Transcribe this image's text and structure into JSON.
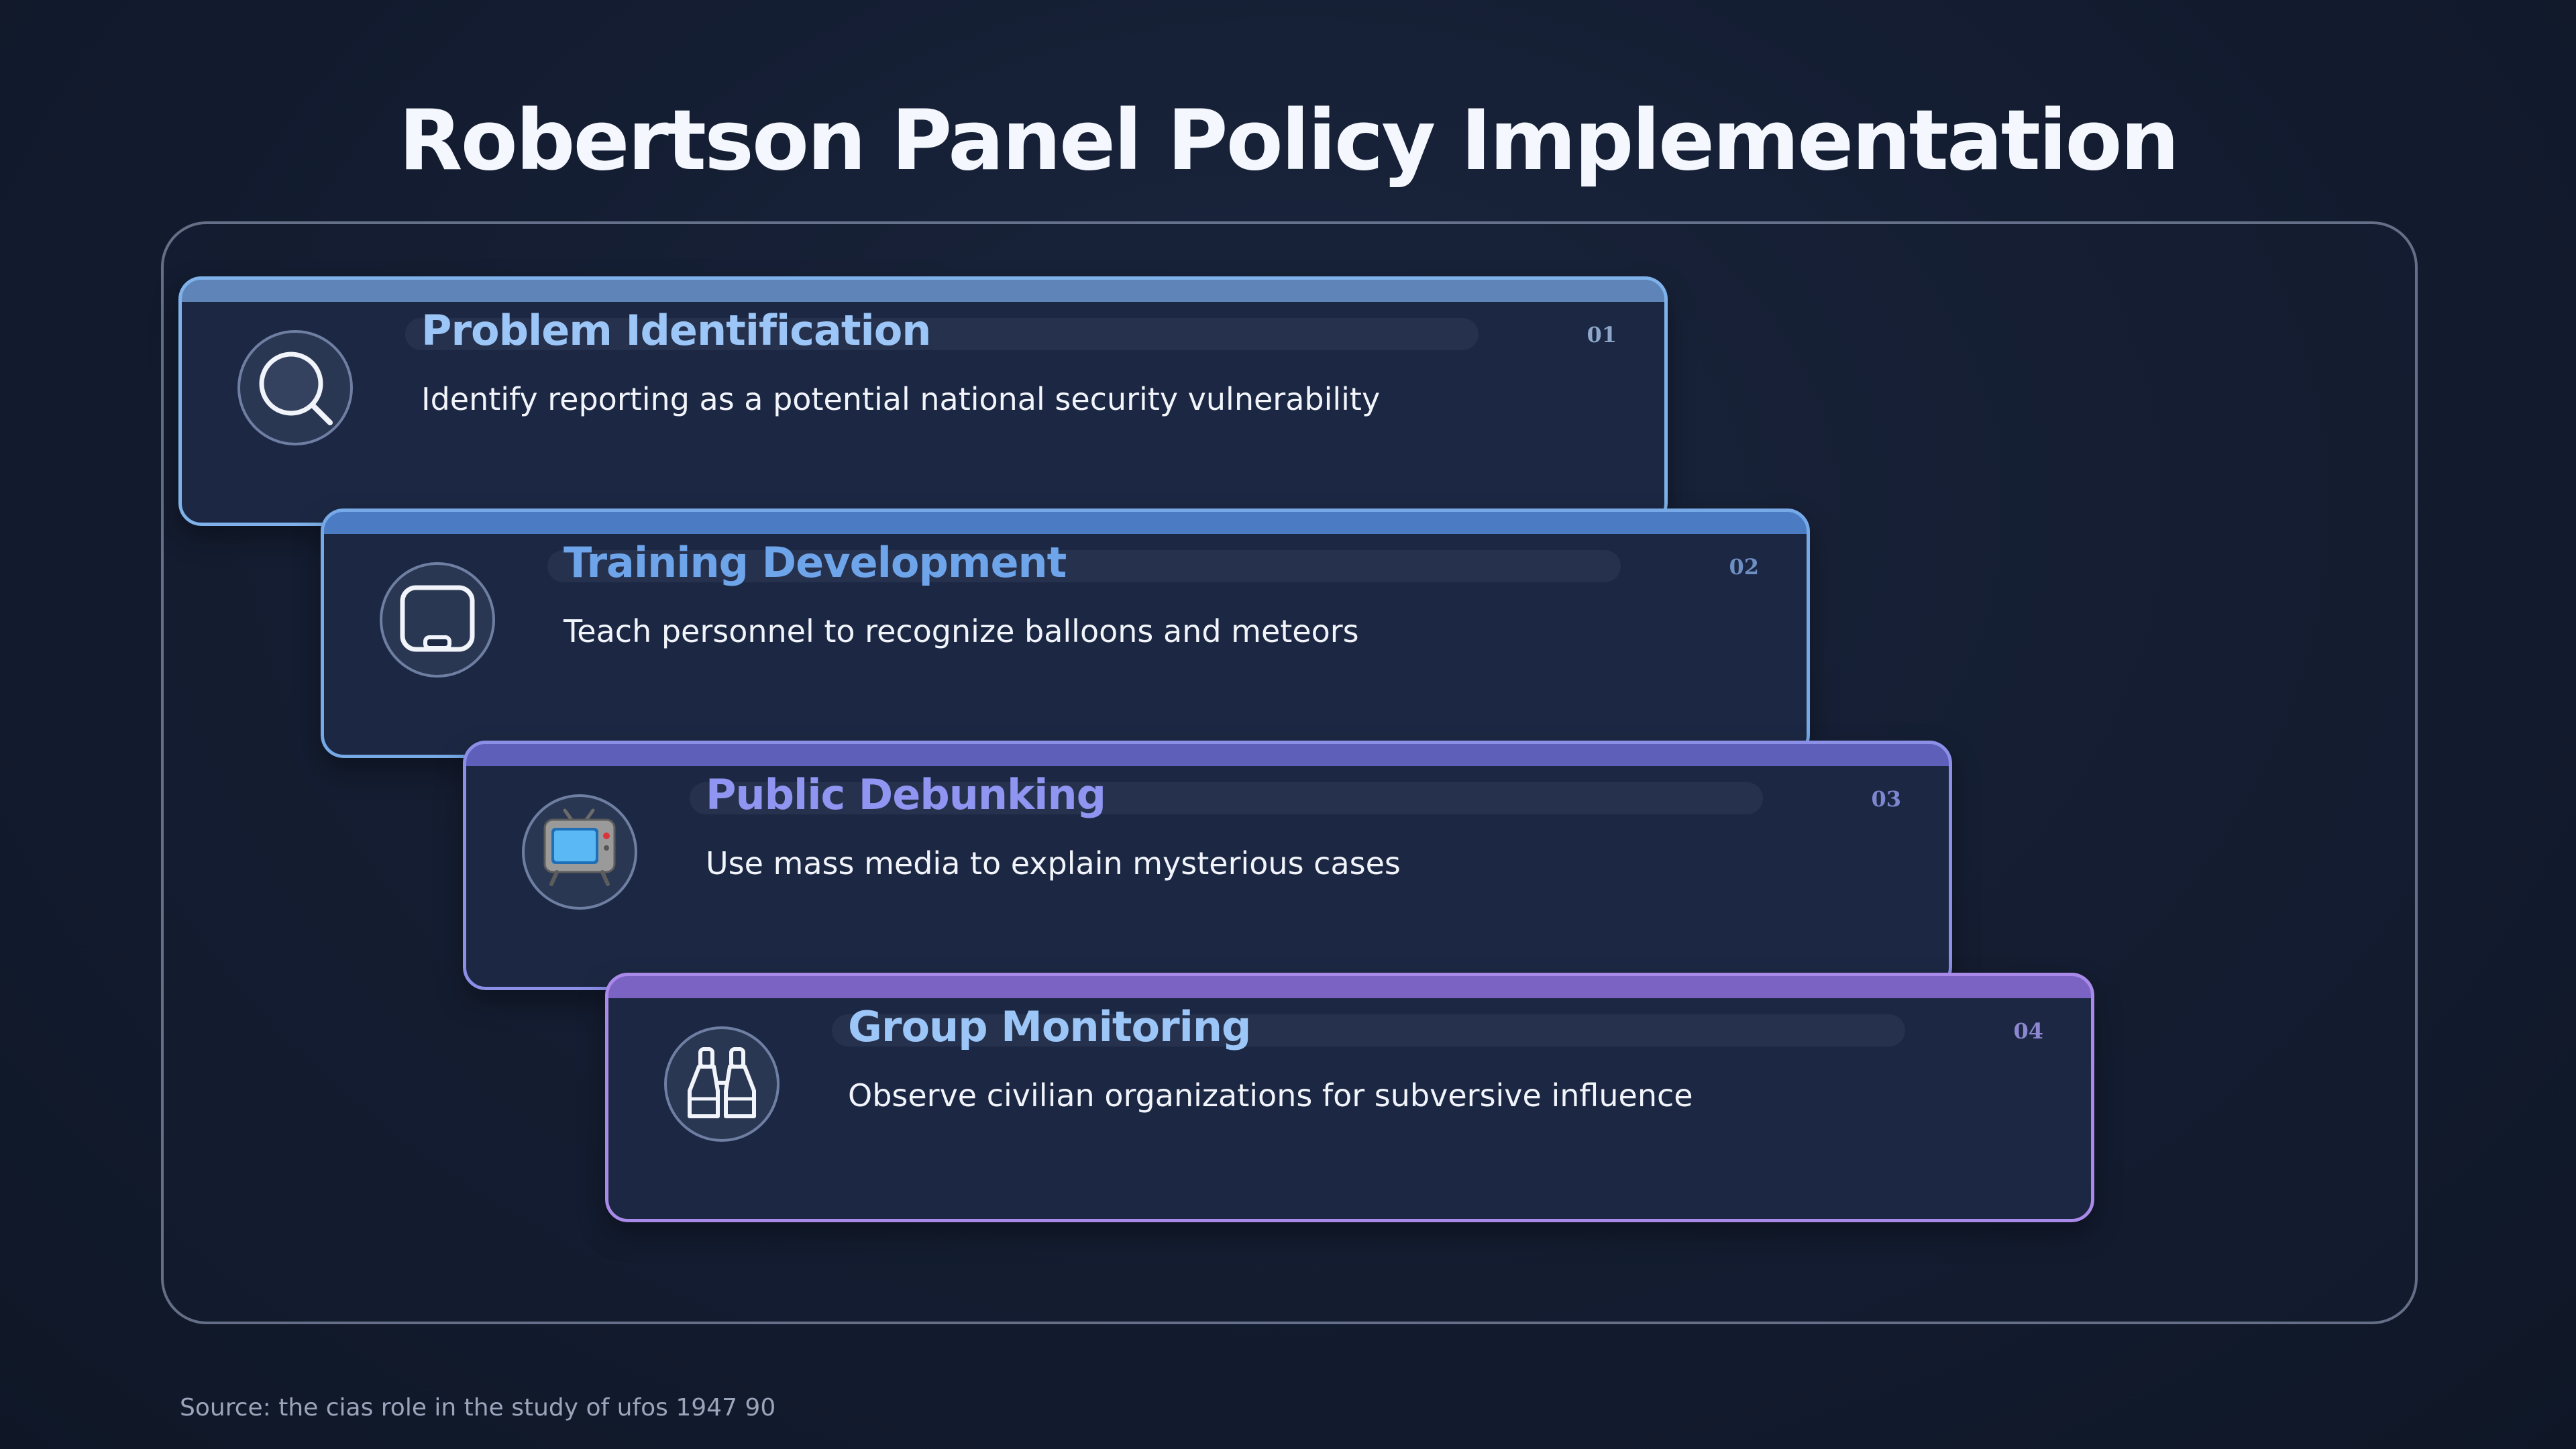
{
  "title": "Robertson Panel Policy Implementation",
  "steps": [
    {
      "number": "01",
      "title": "Problem Identification",
      "description": "Identify reporting as a potential national security vulnerability",
      "icon": "magnifying-glass-icon",
      "title_color": "#9cc6f7",
      "number_color": "#8ea6c9",
      "accent_color": "#7fb2ea",
      "bar_color": "#5f85b8"
    },
    {
      "number": "02",
      "title": "Training Development",
      "description": "Teach personnel to recognize balloons and meteors",
      "icon": "chalkboard-icon",
      "title_color": "#6ea4ea",
      "number_color": "#6d8fc2",
      "accent_color": "#76a9e6",
      "bar_color": "#4b7bc2"
    },
    {
      "number": "03",
      "title": "Public Debunking",
      "description": "Use mass media to explain mysterious cases",
      "icon": "television-icon",
      "title_color": "#8f95f0",
      "number_color": "#7f87d0",
      "accent_color": "#8b8fe6",
      "bar_color": "#5d5fb8"
    },
    {
      "number": "04",
      "title": "Group Monitoring",
      "description": "Observe civilian organizations for subversive influence",
      "icon": "binoculars-icon",
      "title_color": "#9cc6f7",
      "number_color": "#8c87d0",
      "accent_color": "#a98ae8",
      "bar_color": "#7b63c4"
    }
  ],
  "source": "Source: the cias role in the study of ufos 1947 90"
}
